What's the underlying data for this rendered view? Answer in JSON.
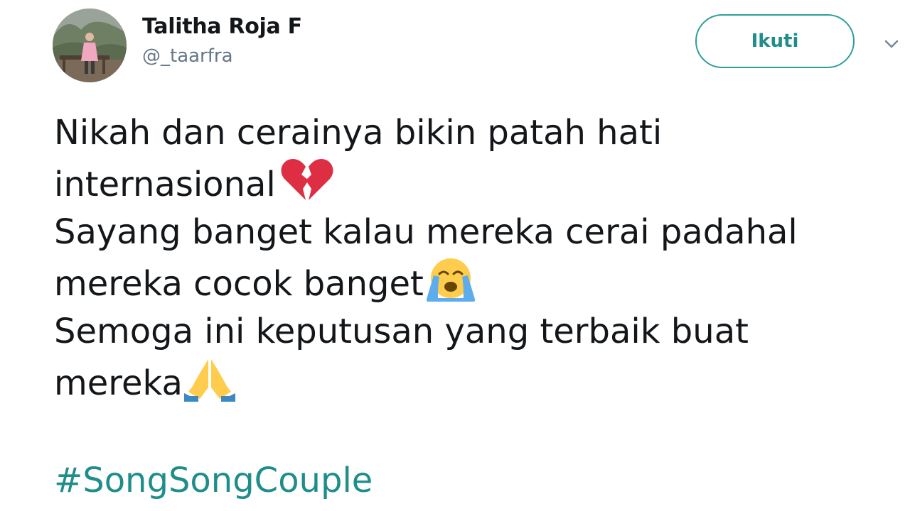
{
  "author": {
    "display_name": "Talitha Roja F",
    "handle": "@_taarfra"
  },
  "follow_button": {
    "label": "Ikuti"
  },
  "tweet": {
    "lines": [
      "Nikah dan cerainya bikin patah hati",
      "internasional",
      "Sayang banget kalau mereka cerai padahal",
      "mereka cocok banget",
      "Semoga ini keputusan yang terbaik buat",
      "mereka"
    ],
    "emojis": [
      "broken-heart-icon",
      "loudly-crying-face-icon",
      "folded-hands-icon"
    ],
    "hashtag": "#SongSongCouple"
  },
  "colors": {
    "accent": "#1f8e8a",
    "text": "#14171a",
    "muted": "#657786"
  },
  "icons": {
    "menu": "chevron-down-icon"
  }
}
